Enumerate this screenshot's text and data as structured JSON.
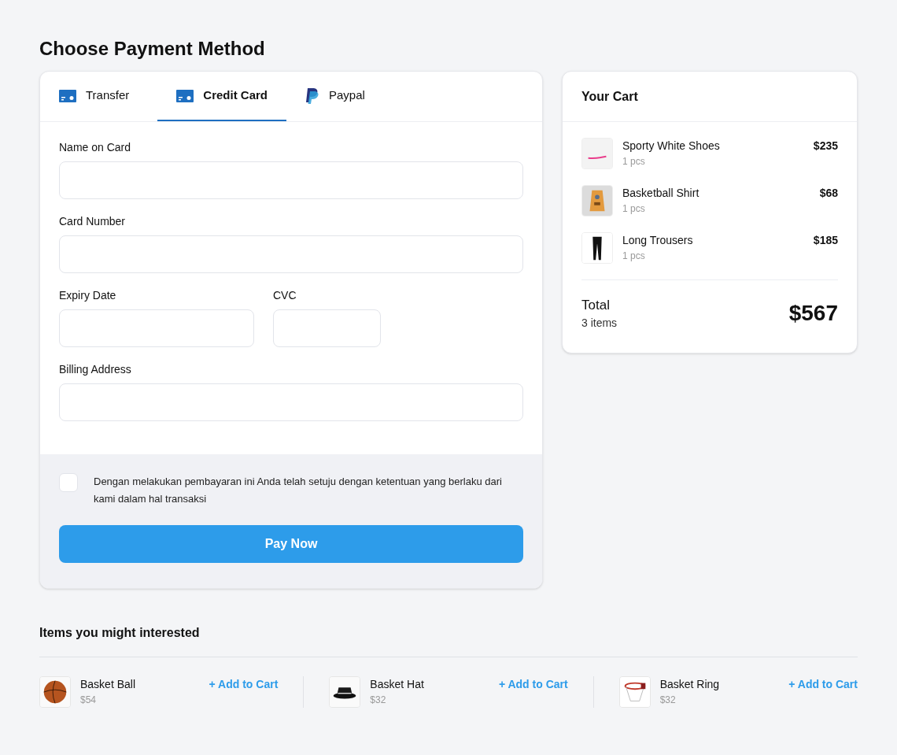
{
  "title": "Choose Payment Method",
  "tabs": [
    {
      "label": "Transfer",
      "selected": false,
      "kind": "card"
    },
    {
      "label": "Credit Card",
      "selected": true,
      "kind": "card"
    },
    {
      "label": "Paypal",
      "selected": false,
      "kind": "paypal"
    }
  ],
  "form": {
    "fields": [
      {
        "label": "Name on Card"
      },
      {
        "label": "Card Number"
      },
      {
        "label": "Expiry Date"
      },
      {
        "label": "CVC"
      },
      {
        "label": "Billing Address"
      }
    ],
    "agreement": {
      "checked": false,
      "text": "Dengan melakukan pembayaran ini Anda telah setuju dengan ketentuan yang berlaku dari kami dalam hal transaksi"
    },
    "button": "Pay Now"
  },
  "cart": {
    "title": "Your Cart",
    "items": [
      {
        "name": "Sporty White Shoes",
        "qty": "1 pcs",
        "price": "$235"
      },
      {
        "name": "Basketball Shirt",
        "qty": "1 pcs",
        "price": "$68"
      },
      {
        "name": "Long Trousers",
        "qty": "1 pcs",
        "price": "$185"
      }
    ],
    "total_label": "Total",
    "count": "3 items",
    "total": "$567"
  },
  "suggestions": {
    "title": "Items you might interested",
    "items": [
      {
        "name": "Basket Ball",
        "price": "$54",
        "action": "+ Add to Cart"
      },
      {
        "name": "Basket Hat",
        "price": "$32",
        "action": "+ Add to Cart"
      },
      {
        "name": "Basket Ring",
        "price": "$32",
        "action": "+ Add to Cart"
      }
    ]
  }
}
